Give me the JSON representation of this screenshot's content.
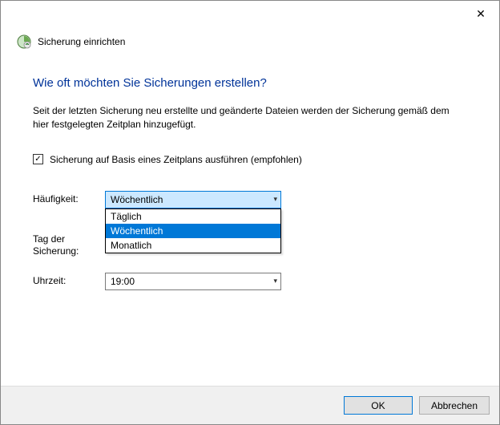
{
  "window": {
    "title": "Sicherung einrichten"
  },
  "heading": "Wie oft möchten Sie Sicherungen erstellen?",
  "description": "Seit der letzten Sicherung neu erstellte und geänderte Dateien werden der Sicherung gemäß dem hier festgelegten Zeitplan hinzugefügt.",
  "schedule_checkbox": {
    "label": "Sicherung auf Basis eines Zeitplans ausführen (empfohlen)",
    "checked": true
  },
  "frequency": {
    "label": "Häufigkeit:",
    "value": "Wöchentlich",
    "options": [
      "Täglich",
      "Wöchentlich",
      "Monatlich"
    ],
    "expanded": true,
    "selected_index": 1
  },
  "day": {
    "label": "Tag der Sicherung:"
  },
  "time": {
    "label": "Uhrzeit:",
    "value": "19:00"
  },
  "buttons": {
    "ok": "OK",
    "cancel": "Abbrechen"
  }
}
